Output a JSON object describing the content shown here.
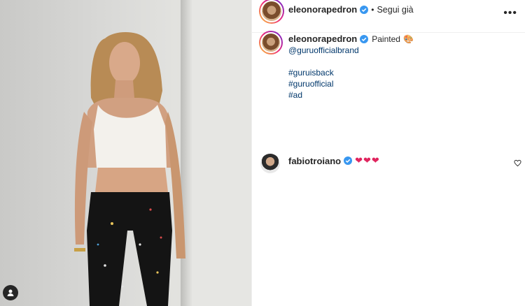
{
  "post": {
    "author": "eleonorapedron",
    "follow_status": "Segui già",
    "more_label": "•••"
  },
  "caption": {
    "author": "eleonorapedron",
    "text": "Painted",
    "emoji": "🎨",
    "mention": "@guruofficialbrand",
    "hashtags": [
      "#guruisback",
      "#guruofficial",
      "#ad"
    ]
  },
  "comments": [
    {
      "author": "fabiotroiano",
      "text": "❤❤❤"
    }
  ],
  "colors": {
    "verified": "#3897f0",
    "link": "#00376b",
    "heart": "#e0245e"
  }
}
